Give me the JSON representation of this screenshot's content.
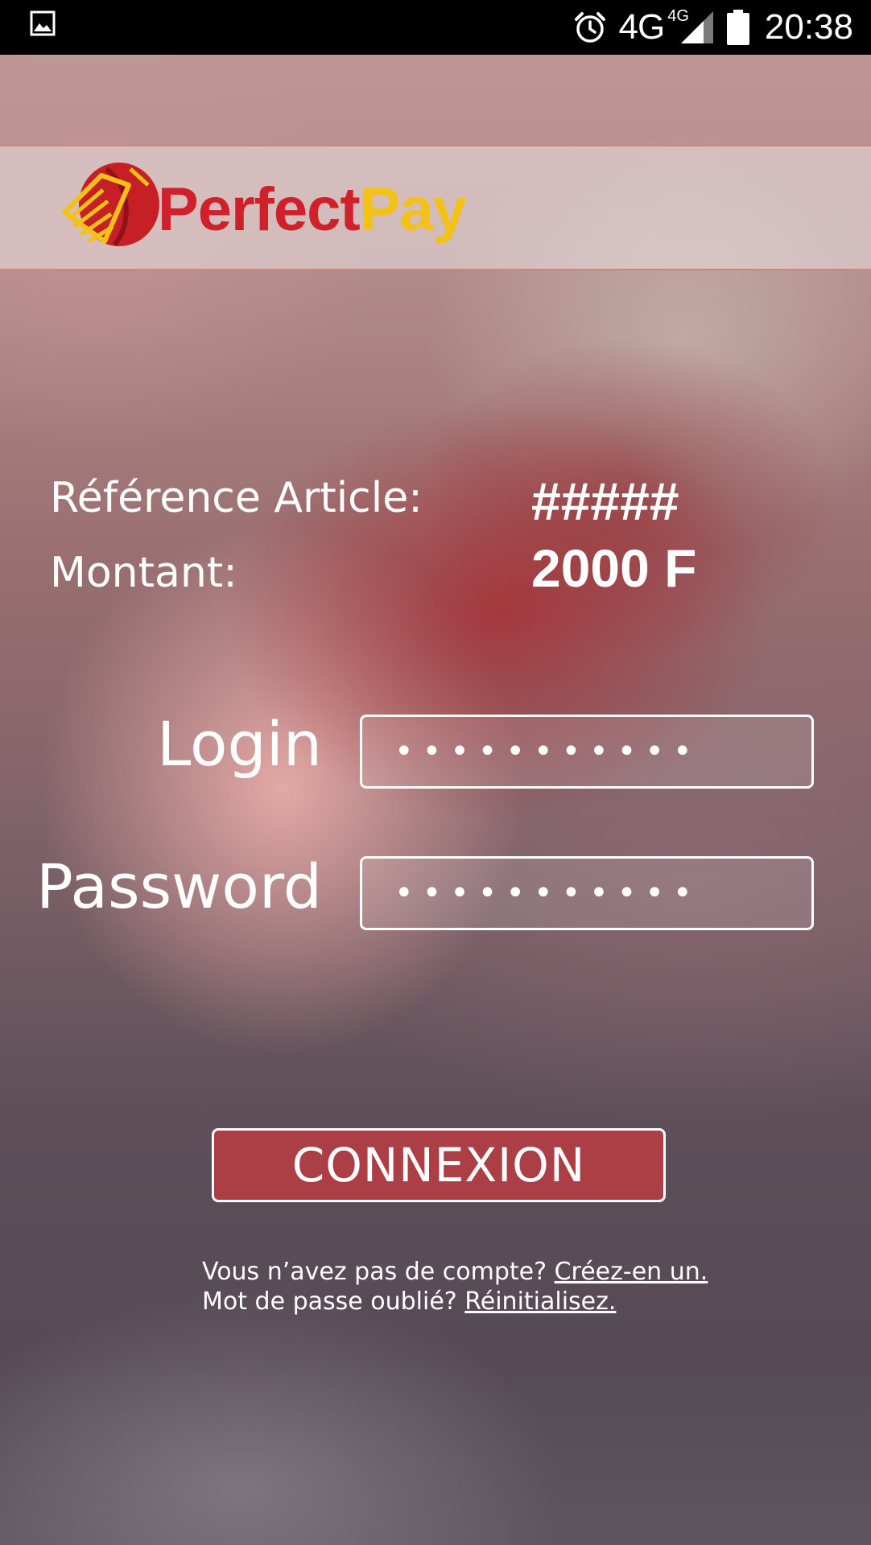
{
  "status_bar": {
    "network": "4G",
    "network_sup": "4G",
    "time": "20:38",
    "icons": [
      "image-icon",
      "alarm-icon",
      "signal-icon",
      "battery-icon"
    ]
  },
  "brand": {
    "name_part1": "Perfect",
    "name_part2": "Pay",
    "colors": {
      "red": "#d0202a",
      "yellow": "#f4c117"
    }
  },
  "order": {
    "reference_label": "Référence Article:",
    "reference_value": "#####",
    "amount_label": "Montant:",
    "amount_value": "2000 F"
  },
  "form": {
    "login_label": "Login",
    "login_value": "•••••••••••",
    "password_label": "Password",
    "password_value": "•••••••••••",
    "submit_label": "CONNEXION",
    "button_color": "#ac3f45"
  },
  "footer": {
    "no_account_text": "Vous n’avez pas de compte?",
    "create_link": "Créez-en un.",
    "forgot_text": "Mot de passe oublié?",
    "reset_link": "Réinitialisez."
  }
}
